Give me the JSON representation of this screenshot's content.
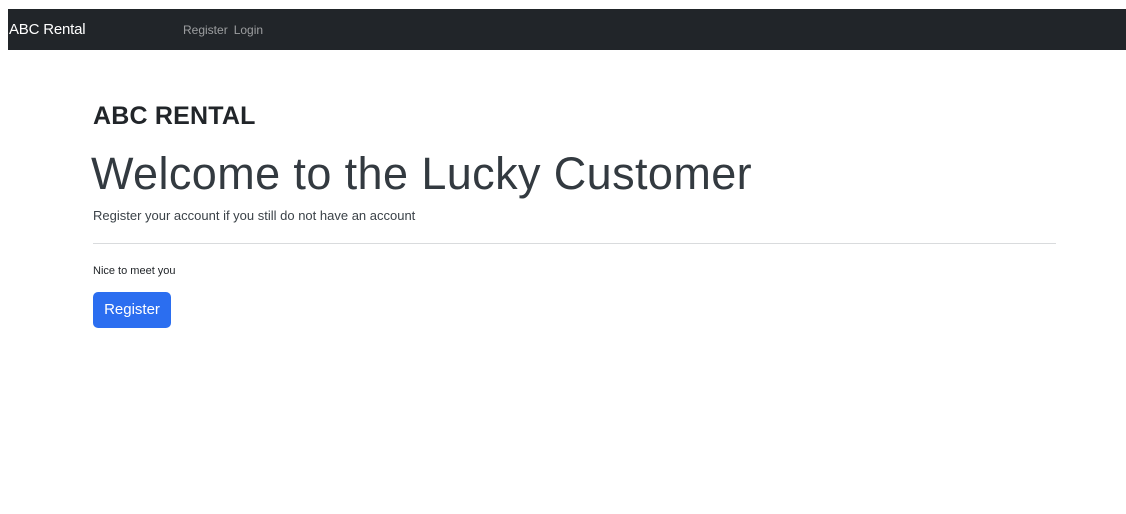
{
  "navbar": {
    "brand": "ABC Rental",
    "links": [
      {
        "label": "Register"
      },
      {
        "label": "Login"
      }
    ]
  },
  "main": {
    "site_heading": "ABC RENTAL",
    "welcome_title": "Welcome to the Lucky Customer",
    "lead_text": "Register your account if you still do not have an account",
    "note_text": "Nice to meet you",
    "register_button_label": "Register"
  },
  "colors": {
    "navbar_bg": "#212529",
    "primary_button": "#2b6ef0",
    "text": "#212529"
  }
}
